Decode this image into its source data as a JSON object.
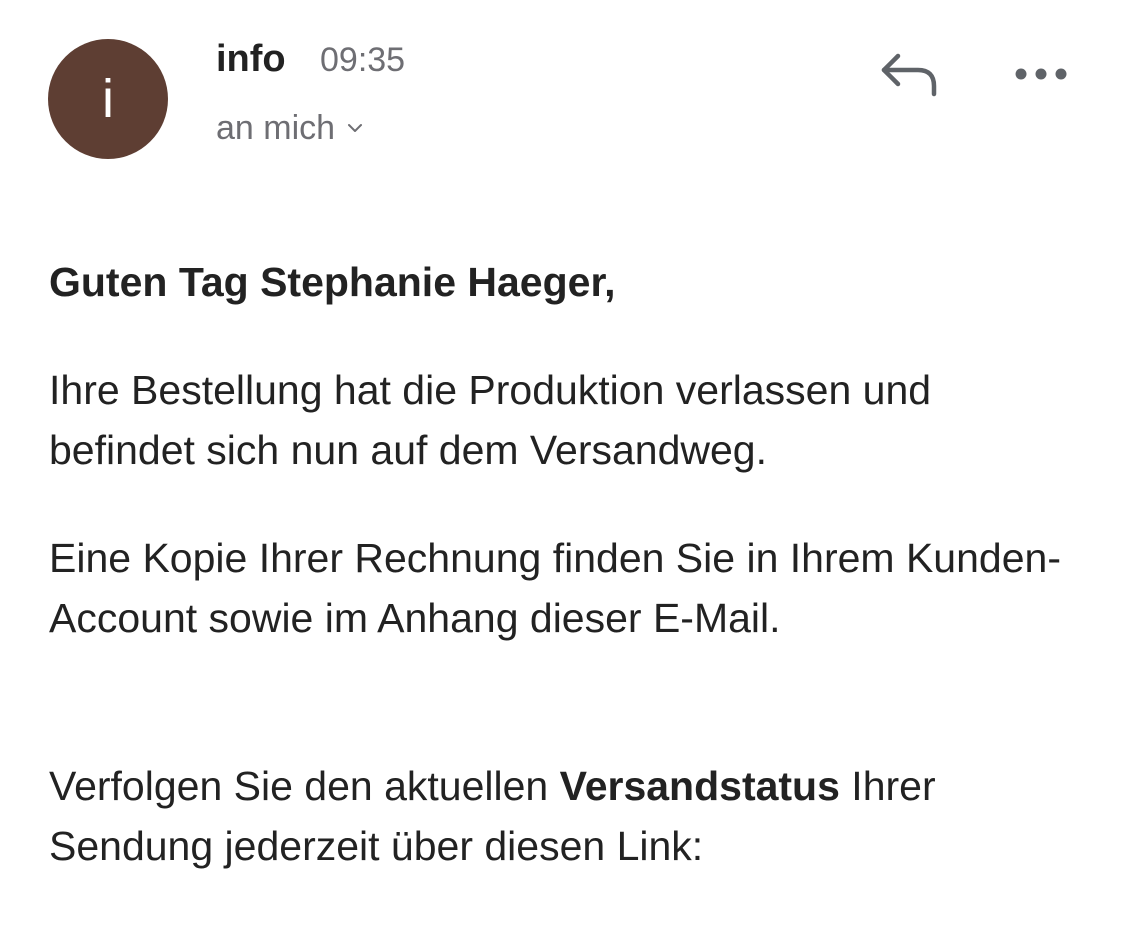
{
  "header": {
    "avatar_letter": "i",
    "avatar_color": "#5e3e33",
    "sender_name": "info",
    "time": "09:35",
    "recipient": "an mich",
    "reply_icon": "reply-icon",
    "more_icon": "more-horizontal-icon"
  },
  "message": {
    "greeting": "Guten Tag Stephanie Haeger,",
    "paragraphs": [
      "Ihre Bestellung hat die Produktion verlassen und befindet sich nun auf dem Versandweg.",
      "Eine Kopie Ihrer Rechnung finden Sie in Ihrem Kunden-Account sowie im Anhang dieser E-Mail."
    ],
    "tracking": {
      "before": "Verfolgen Sie den aktuellen ",
      "bold": "Versandstatus",
      "after": " Ihrer Sendung jederzeit über diesen Link:"
    }
  }
}
